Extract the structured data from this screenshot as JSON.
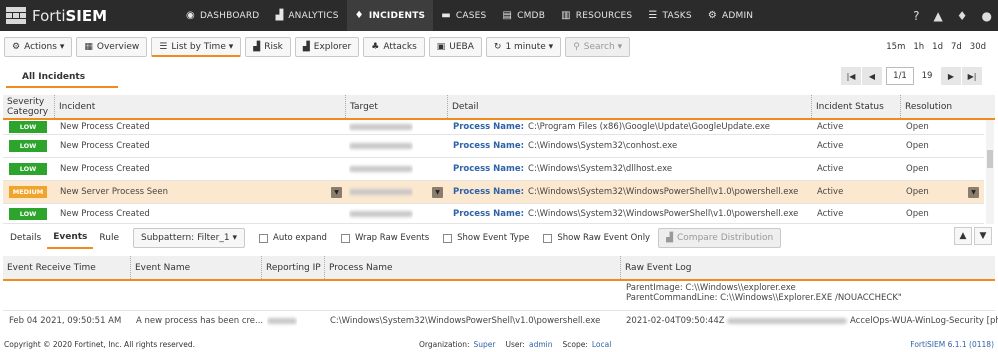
{
  "app": {
    "brand_plain": "Forti",
    "brand_bold": "SIEM"
  },
  "nav": [
    {
      "icon": "dashboard-icon",
      "glyph": "◉",
      "label": "DASHBOARD"
    },
    {
      "icon": "analytics-icon",
      "glyph": "▟",
      "label": "ANALYTICS"
    },
    {
      "icon": "bell-icon",
      "glyph": "🔔",
      "label": "INCIDENTS"
    },
    {
      "icon": "folder-icon",
      "glyph": "▬",
      "label": "CASES"
    },
    {
      "icon": "cmdb-icon",
      "glyph": "▤",
      "label": "CMDB"
    },
    {
      "icon": "resources-icon",
      "glyph": "▥",
      "label": "RESOURCES"
    },
    {
      "icon": "tasks-icon",
      "glyph": "☰",
      "label": "TASKS"
    },
    {
      "icon": "admin-icon",
      "glyph": "⚙",
      "label": "ADMIN"
    }
  ],
  "active_nav": "INCIDENTS",
  "toolbar": {
    "actions": "Actions",
    "overview": "Overview",
    "list_by_time": "List by Time",
    "risk": "Risk",
    "explorer": "Explorer",
    "attacks": "Attacks",
    "ueba": "UEBA",
    "refresh": "1 minute",
    "search": "Search"
  },
  "time_ranges": [
    "15m",
    "1h",
    "1d",
    "7d",
    "30d"
  ],
  "incident_tab": "All Incidents",
  "pager": {
    "current": "1/1",
    "total": "19"
  },
  "incidents": {
    "columns": [
      "Severity Category",
      "Incident",
      "Target",
      "Detail",
      "Incident Status",
      "Resolution"
    ],
    "detail_key": "Process Name:",
    "rows": [
      {
        "severity": "LOW",
        "incident": "New Process Created",
        "detail": "C:\\Program Files (x86)\\Google\\Update\\GoogleUpdate.exe",
        "status": "Active",
        "resolution": "Open"
      },
      {
        "severity": "LOW",
        "incident": "New Process Created",
        "detail": "C:\\Windows\\System32\\conhost.exe",
        "status": "Active",
        "resolution": "Open"
      },
      {
        "severity": "LOW",
        "incident": "New Process Created",
        "detail": "C:\\Windows\\System32\\dllhost.exe",
        "status": "Active",
        "resolution": "Open"
      },
      {
        "severity": "MEDIUM",
        "incident": "New Server Process Seen",
        "detail": "C:\\Windows\\System32\\WindowsPowerShell\\v1.0\\powershell.exe",
        "status": "Active",
        "resolution": "Open"
      },
      {
        "severity": "LOW",
        "incident": "New Process Created",
        "detail": "C:\\Windows\\System32\\WindowsPowerShell\\v1.0\\powershell.exe",
        "status": "Active",
        "resolution": "Open"
      }
    ]
  },
  "panel": {
    "tabs": [
      "Details",
      "Events",
      "Rule"
    ],
    "active_tab": "Events",
    "subpattern": "Subpattern: Filter_1",
    "checks": [
      "Auto expand",
      "Wrap Raw Events",
      "Show Event Type",
      "Show Raw Event Only"
    ],
    "compare": "Compare Distribution"
  },
  "events": {
    "columns": [
      "Event Receive Time",
      "Event Name",
      "Reporting IP",
      "Process Name",
      "Raw Event Log"
    ],
    "raw_prev_lines": [
      "ParentImage: C:\\\\Windows\\\\explorer.exe",
      "ParentCommandLine: C:\\\\Windows\\\\Explorer.EXE /NOUACCHECK\""
    ],
    "row": {
      "time": "Feb 04 2021, 09:50:51 AM",
      "name": "A new process has been cre...",
      "process": "C:\\Windows\\System32\\WindowsPowerShell\\v1.0\\powershell.exe",
      "raw_start": "2021-02-04T09:50:44Z",
      "raw_end": "AccelOps-WUA-WinLog-Security [ph..."
    }
  },
  "footer": {
    "copyright": "Copyright © 2020 Fortinet, Inc. All rights reserved.",
    "org_label": "Organization:",
    "org": "Super",
    "user_label": "User:",
    "user": "admin",
    "scope_label": "Scope:",
    "scope": "Local",
    "version": "FortiSIEM 6.1.1 (0118)"
  },
  "colors": {
    "accent": "#f08c1e",
    "low": "#2da52d",
    "medium": "#f0a52a",
    "link": "#2f63a8",
    "topbar": "#2b2b2b"
  }
}
